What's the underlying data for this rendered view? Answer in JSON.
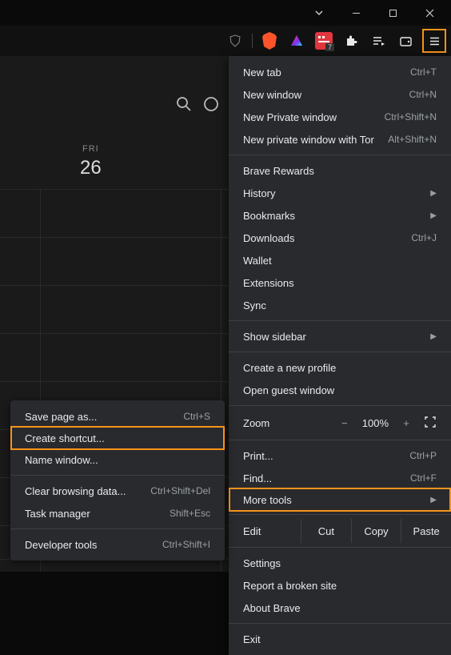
{
  "window": {
    "minimize": "—",
    "maximize": "□",
    "close": "✕"
  },
  "toolbar": {
    "ext_badge": "7"
  },
  "background": {
    "day_label": "FRI",
    "day_num": "26"
  },
  "menu": {
    "new_tab": {
      "label": "New tab",
      "shortcut": "Ctrl+T"
    },
    "new_window": {
      "label": "New window",
      "shortcut": "Ctrl+N"
    },
    "new_private": {
      "label": "New Private window",
      "shortcut": "Ctrl+Shift+N"
    },
    "new_tor": {
      "label": "New private window with Tor",
      "shortcut": "Alt+Shift+N"
    },
    "brave_rewards": {
      "label": "Brave Rewards"
    },
    "history": {
      "label": "History"
    },
    "bookmarks": {
      "label": "Bookmarks"
    },
    "downloads": {
      "label": "Downloads",
      "shortcut": "Ctrl+J"
    },
    "wallet": {
      "label": "Wallet"
    },
    "extensions": {
      "label": "Extensions"
    },
    "sync": {
      "label": "Sync"
    },
    "show_sidebar": {
      "label": "Show sidebar"
    },
    "create_profile": {
      "label": "Create a new profile"
    },
    "guest": {
      "label": "Open guest window"
    },
    "zoom": {
      "label": "Zoom",
      "minus": "−",
      "value": "100%",
      "plus": "+"
    },
    "print": {
      "label": "Print...",
      "shortcut": "Ctrl+P"
    },
    "find": {
      "label": "Find...",
      "shortcut": "Ctrl+F"
    },
    "more_tools": {
      "label": "More tools"
    },
    "edit": {
      "label": "Edit",
      "cut": "Cut",
      "copy": "Copy",
      "paste": "Paste"
    },
    "settings": {
      "label": "Settings"
    },
    "report": {
      "label": "Report a broken site"
    },
    "about": {
      "label": "About Brave"
    },
    "exit": {
      "label": "Exit"
    }
  },
  "submenu": {
    "save_as": {
      "label": "Save page as...",
      "shortcut": "Ctrl+S"
    },
    "create_shortcut": {
      "label": "Create shortcut..."
    },
    "name_window": {
      "label": "Name window..."
    },
    "clear_data": {
      "label": "Clear browsing data...",
      "shortcut": "Ctrl+Shift+Del"
    },
    "task_manager": {
      "label": "Task manager",
      "shortcut": "Shift+Esc"
    },
    "dev_tools": {
      "label": "Developer tools",
      "shortcut": "Ctrl+Shift+I"
    }
  }
}
